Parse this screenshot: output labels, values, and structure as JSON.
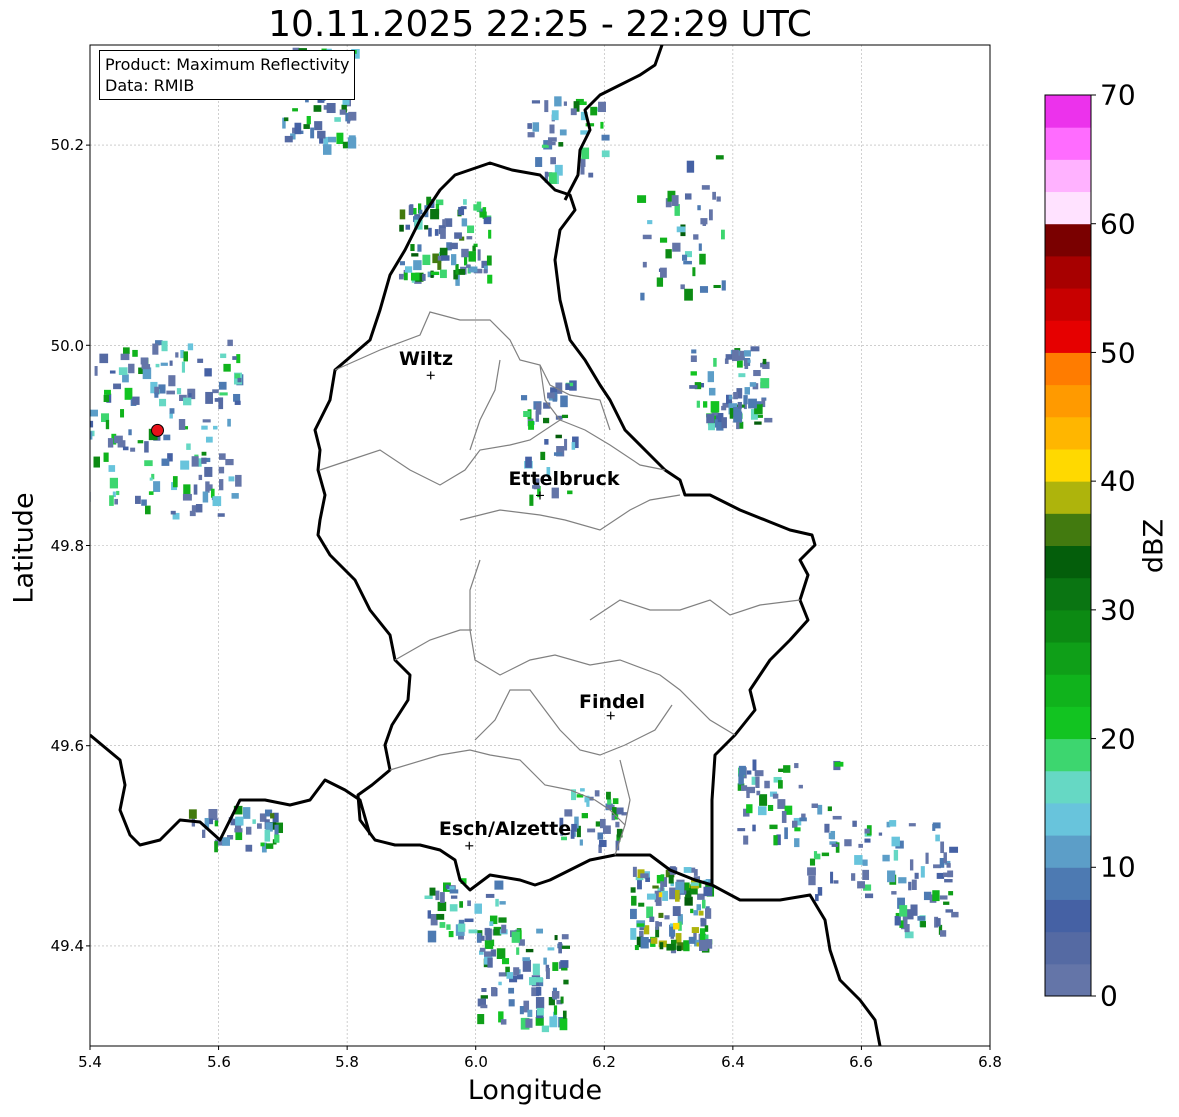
{
  "title": "10.11.2025 22:25 - 22:29 UTC",
  "info": {
    "product": "Product: Maximum Reflectivity",
    "source": "Data: RMIB"
  },
  "axes": {
    "xlabel": "Longitude",
    "ylabel": "Latitude",
    "xlim": [
      5.4,
      6.8
    ],
    "ylim": [
      49.3,
      50.3
    ],
    "xticks": [
      "5.4",
      "5.6",
      "5.8",
      "6.0",
      "6.2",
      "6.4",
      "6.6",
      "6.8"
    ],
    "yticks": [
      "49.4",
      "49.6",
      "49.8",
      "50.0",
      "50.2"
    ],
    "grid": true
  },
  "cities": [
    {
      "name": "Wiltz",
      "lon": 5.93,
      "lat": 49.97
    },
    {
      "name": "Ettelbruck",
      "lon": 6.1,
      "lat": 49.85
    },
    {
      "name": "Findel",
      "lon": 6.21,
      "lat": 49.63
    },
    {
      "name": "Esch/Alzette",
      "lon": 5.99,
      "lat": 49.5
    }
  ],
  "radar_site": {
    "lon": 5.505,
    "lat": 49.915,
    "color": "#e8121a"
  },
  "colorbar": {
    "label": "dBZ",
    "min": 0,
    "max": 70,
    "ticks": [
      "0",
      "10",
      "20",
      "30",
      "40",
      "50",
      "60",
      "70"
    ],
    "colors": [
      "#6475a8",
      "#556aa3",
      "#4561a4",
      "#4d7ab2",
      "#5c9ec8",
      "#68c4dc",
      "#66d8c4",
      "#3dd66f",
      "#12c421",
      "#10b31c",
      "#0f9f18",
      "#0c8a13",
      "#0a7512",
      "#045e0b",
      "#427a0f",
      "#aeb40c",
      "#ffd900",
      "#ffb600",
      "#ff9a00",
      "#ff7c00",
      "#e60000",
      "#c80000",
      "#a70000",
      "#7a0000",
      "#ffe2ff",
      "#ffb2ff",
      "#ff6cff",
      "#ec32ec"
    ]
  }
}
